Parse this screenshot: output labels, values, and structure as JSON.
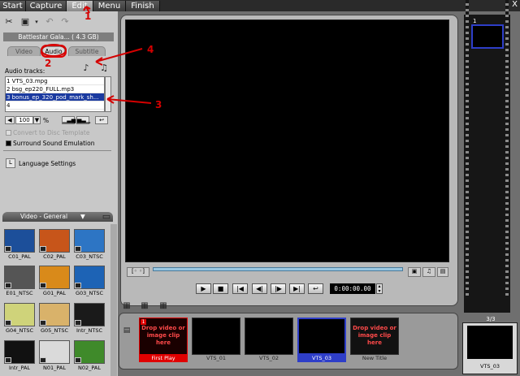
{
  "menu": {
    "tabs": [
      {
        "label": "Start"
      },
      {
        "label": "Capture"
      },
      {
        "label": "Edit"
      },
      {
        "label": "Menu"
      },
      {
        "label": "Finish"
      }
    ],
    "close_label": "X"
  },
  "project": {
    "name": "Battlestar Gala... ( 4.3 GB)"
  },
  "subtabs": [
    "Video",
    "Audio",
    "Subtitle"
  ],
  "audio": {
    "label": "Audio tracks:",
    "tracks": [
      "1 VTS_03.mpg",
      "2 bsg_ep220_FULL.mp3",
      "3 bonus_ep_320_pod_mark_sh...",
      "4"
    ],
    "volume": "100",
    "volume_unit": "%",
    "convert_label": "Convert to Disc Template",
    "surround_label": "Surround Sound Emulation",
    "language_label": "Language Settings"
  },
  "library": {
    "header": "Video - General",
    "thumbs": [
      {
        "label": "C01_PAL",
        "color": "#1c4f9a"
      },
      {
        "label": "C02_PAL",
        "color": "#c7551a"
      },
      {
        "label": "C03_NTSC",
        "color": "#2d75c4"
      },
      {
        "label": "E01_NTSC",
        "color": "#555555"
      },
      {
        "label": "G01_PAL",
        "color": "#d98a1a"
      },
      {
        "label": "G03_NTSC",
        "color": "#1d63b5"
      },
      {
        "label": "G04_NTSC",
        "color": "#cfd37a"
      },
      {
        "label": "G05_NTSC",
        "color": "#d9b26a"
      },
      {
        "label": "Intr_NTSC",
        "color": "#1a1a1a"
      },
      {
        "label": "Intr_PAL",
        "color": "#111111"
      },
      {
        "label": "N01_PAL",
        "color": "#dadada"
      },
      {
        "label": "N02_PAL",
        "color": "#3f8a2a"
      }
    ]
  },
  "player": {
    "timecode": "0:00:00.00"
  },
  "filmstrip": {
    "index": "1",
    "count": "3/3",
    "preview_label": "VTS_03"
  },
  "timeline": {
    "slots": [
      {
        "label": "First Play",
        "drop_text": "Drop video or image clip here",
        "marker": "1"
      },
      {
        "label": "VTS_01"
      },
      {
        "label": "VTS_02"
      },
      {
        "label": "VTS_03"
      },
      {
        "label": "New Title",
        "drop_text": "Drop video or image clip here"
      }
    ]
  },
  "annotations": [
    "1",
    "2",
    "3",
    "4"
  ]
}
